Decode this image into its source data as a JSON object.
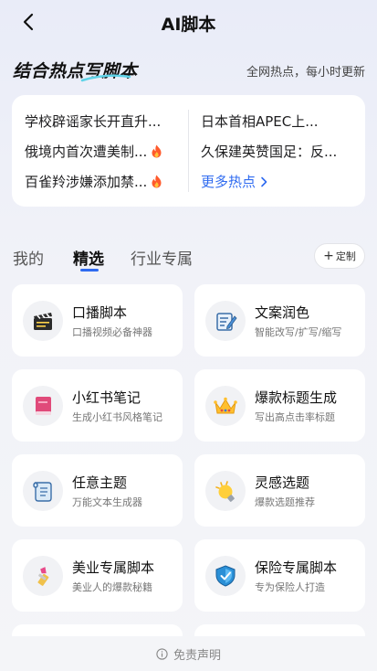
{
  "header": {
    "title": "AI脚本",
    "back_icon": "chevron-left-icon"
  },
  "hot": {
    "heading": "结合热点写脚本",
    "subheading": "全网热点，每小时更新",
    "left": [
      {
        "text": "学校辟谣家长开直升...",
        "fire": false
      },
      {
        "text": "俄境内首次遭美制...",
        "fire": true
      },
      {
        "text": "百雀羚涉嫌添加禁...",
        "fire": true
      }
    ],
    "right": [
      {
        "text": "日本首相APEC上..."
      },
      {
        "text": "久保建英赞国足：反..."
      }
    ],
    "more_label": "更多热点",
    "accent_color": "#2f6bf0"
  },
  "tabs": {
    "items": [
      "我的",
      "精选",
      "行业专属"
    ],
    "active": "精选",
    "custom_label": "定制"
  },
  "templates": [
    {
      "name": "口播脚本",
      "desc": "口播视频必备神器",
      "icon": "clapperboard-icon"
    },
    {
      "name": "文案润色",
      "desc": "智能改写/扩写/缩写",
      "icon": "notepad-pen-icon"
    },
    {
      "name": "小红书笔记",
      "desc": "生成小红书风格笔记",
      "icon": "book-icon"
    },
    {
      "name": "爆款标题生成",
      "desc": "写出高点击率标题",
      "icon": "crown-icon"
    },
    {
      "name": "任意主题",
      "desc": "万能文本生成器",
      "icon": "scroll-icon"
    },
    {
      "name": "灵感选题",
      "desc": "爆款选题推荐",
      "icon": "lightbulb-icon"
    },
    {
      "name": "美业专属脚本",
      "desc": "美业人的爆款秘籍",
      "icon": "lipstick-icon"
    },
    {
      "name": "保险专属脚本",
      "desc": "专为保险人打造",
      "icon": "shield-icon"
    }
  ],
  "footer": {
    "label": "免责声明",
    "icon": "info-icon"
  }
}
